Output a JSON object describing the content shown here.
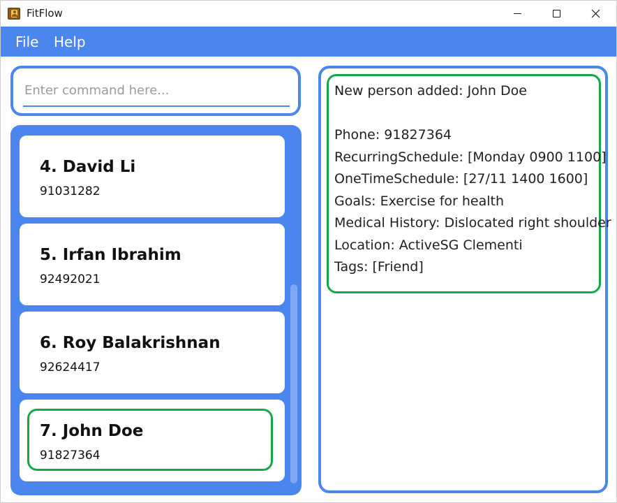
{
  "window": {
    "title": "FitFlow"
  },
  "menu": {
    "file": "File",
    "help": "Help"
  },
  "command": {
    "placeholder": "Enter command here...",
    "value": ""
  },
  "persons": [
    {
      "name": "4. David Li",
      "phone": "91031282"
    },
    {
      "name": "5. Irfan Ibrahim",
      "phone": "92492021"
    },
    {
      "name": "6. Roy Balakrishnan",
      "phone": "92624417"
    },
    {
      "name": "7. John Doe",
      "phone": "91827364"
    }
  ],
  "result": {
    "headline": "New person added: John Doe",
    "phone": "Phone: 91827364",
    "recurring": "RecurringSchedule: [Monday 0900 1100]",
    "onetime": "OneTimeSchedule: [27/11 1400 1600]",
    "goals": "Goals: Exercise for health",
    "medical": "Medical History: Dislocated right shoulder",
    "location": "Location: ActiveSG Clementi",
    "tags": "Tags: [Friend]"
  },
  "colors": {
    "accent": "#4a86ee",
    "highlight": "#12a84b"
  }
}
